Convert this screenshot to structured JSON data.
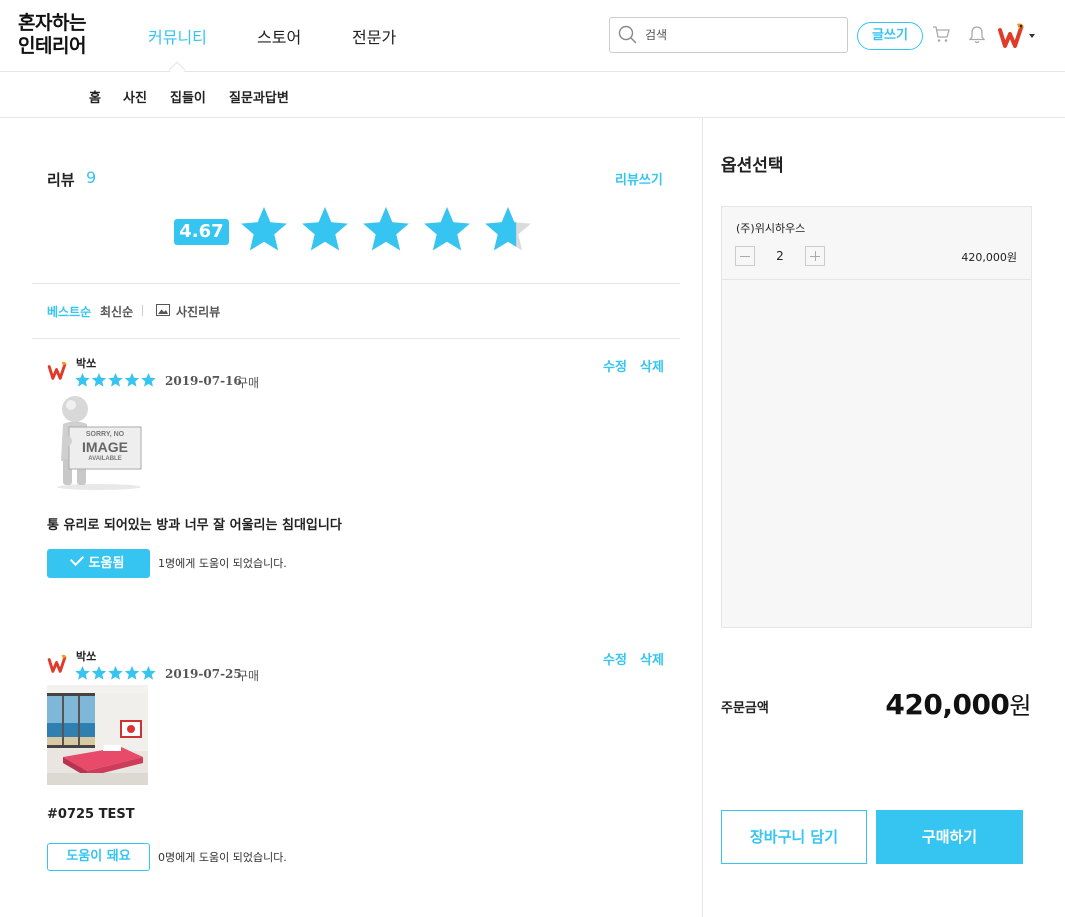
{
  "header": {
    "logo_line1": "혼자하는",
    "logo_line2": "인테리어",
    "nav": [
      "커뮤니티",
      "스토어",
      "전문가"
    ],
    "search_placeholder": "검색",
    "write_label": "글쓰기",
    "accent": "#35c5f0"
  },
  "subnav": [
    "홈",
    "사진",
    "집들이",
    "질문과답변"
  ],
  "reviews": {
    "title": "리뷰",
    "count": "9",
    "write_link": "리뷰쓰기",
    "rating": "4.67",
    "rating_value": 4.67,
    "sort": {
      "best": "베스트순",
      "recent": "최신순",
      "photo": "사진리뷰"
    },
    "items": [
      {
        "author": "박쏘",
        "stars": 5,
        "date": "2019-07-16",
        "purchase": "구매",
        "edit": "수정",
        "delete": "삭제",
        "image_text": [
          "SORRY, NO",
          "IMAGE",
          "AVAILABLE"
        ],
        "text": "통 유리로 되어있는 방과 너무 잘 어울리는 침대입니다",
        "help_label": "도움됨",
        "help_count": "1명에게 도움이 되었습니다."
      },
      {
        "author": "박쏘",
        "stars": 5,
        "date": "2019-07-25",
        "purchase": "구매",
        "edit": "수정",
        "delete": "삭제",
        "text": "#0725 TEST",
        "help_label": "도움이 돼요",
        "help_count": "0명에게 도움이 되었습니다."
      }
    ]
  },
  "options": {
    "title": "옵션선택",
    "item_name": "(주)위시하우스",
    "quantity": "2",
    "item_price": "420,000원",
    "total_label": "주문금액",
    "total_value": "420,000",
    "total_unit": "원",
    "cart_label": "장바구니 담기",
    "buy_label": "구매하기"
  }
}
